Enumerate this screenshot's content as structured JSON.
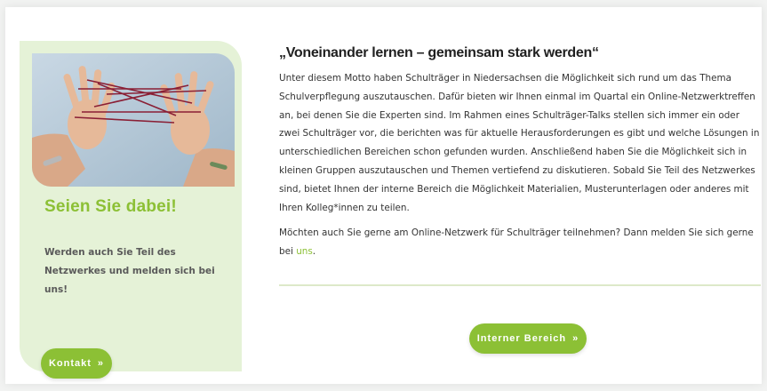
{
  "card": {
    "title": "Seien Sie dabei!",
    "text": "Werden auch Sie Teil des Netzwerkes und melden sich bei uns!",
    "button_label": "Kontakt",
    "button_icon": "chevron-right-icon"
  },
  "article": {
    "heading": "„Voneinander lernen – gemeinsam stark werden“",
    "paragraph1": "Unter diesem Motto haben Schulträger in Niedersachsen die Möglichkeit sich rund um das Thema Schulverpflegung auszutauschen. Dafür bieten wir Ihnen einmal im Quartal ein Online-Netzwerktreffen an, bei denen Sie die Experten sind. Im Rahmen eines Schulträger-Talks stellen sich immer ein oder zwei Schulträger vor, die berichten was für aktuelle Herausforderungen es gibt und welche Lösungen in unterschiedlichen Bereichen schon gefunden wurden. Anschließend haben Sie die Möglichkeit sich in kleinen Gruppen auszutauschen und Themen vertiefend zu diskutieren. Sobald Sie Teil des Netzwerkes sind, bietet Ihnen der interne Bereich die Möglichkeit Materialien, Musterunterlagen oder anderes mit Ihren Kolleg*innen zu teilen.",
    "paragraph2_before": "Möchten auch Sie gerne am Online-Netzwerk für Schulträger teilnehmen? Dann melden Sie sich gerne bei ",
    "paragraph2_link": "uns",
    "paragraph2_after": ".",
    "button_label": "Interner Bereich",
    "button_icon": "chevron-right-icon"
  },
  "colors": {
    "accent": "#8cc035",
    "card_background": "#e5f2d7"
  }
}
